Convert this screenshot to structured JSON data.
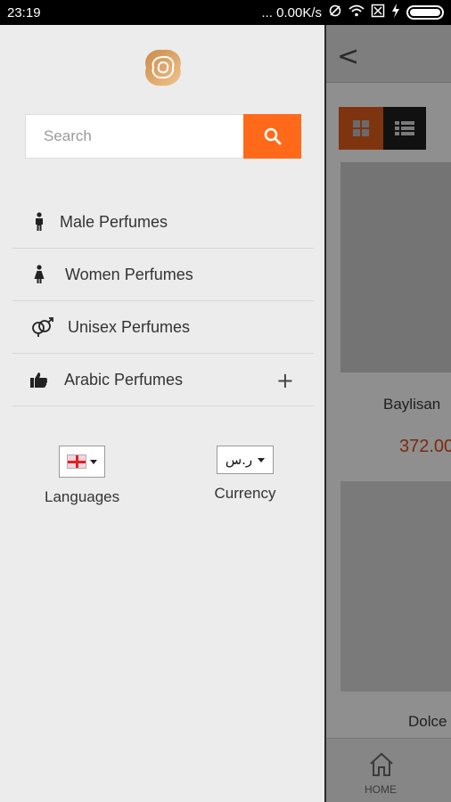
{
  "status_bar": {
    "time": "23:19",
    "network_speed": "... 0.00K/s",
    "icons": [
      "sync-icon",
      "wifi-icon",
      "sim-icon",
      "charging-icon",
      "battery-icon"
    ]
  },
  "drawer": {
    "search": {
      "placeholder": "Search"
    },
    "menu": [
      {
        "label": "Male Perfumes",
        "icon": "male-icon"
      },
      {
        "label": "Women Perfumes",
        "icon": "female-icon"
      },
      {
        "label": "Unisex Perfumes",
        "icon": "unisex-icon"
      },
      {
        "label": "Arabic Perfumes",
        "icon": "thumbs-up-icon",
        "expandable": "+"
      }
    ],
    "language": {
      "label": "Languages",
      "selected_icon": "uk-flag-icon"
    },
    "currency": {
      "label": "Currency",
      "selected": "ر.س"
    }
  },
  "background_screen": {
    "products": [
      {
        "name": "Baylisan",
        "price": "372.00"
      },
      {
        "name": "Dolce"
      }
    ],
    "bottom_nav": {
      "home_label": "HOME"
    }
  },
  "colors": {
    "accent": "#ff6a1a",
    "drawer_bg": "#ececec"
  }
}
